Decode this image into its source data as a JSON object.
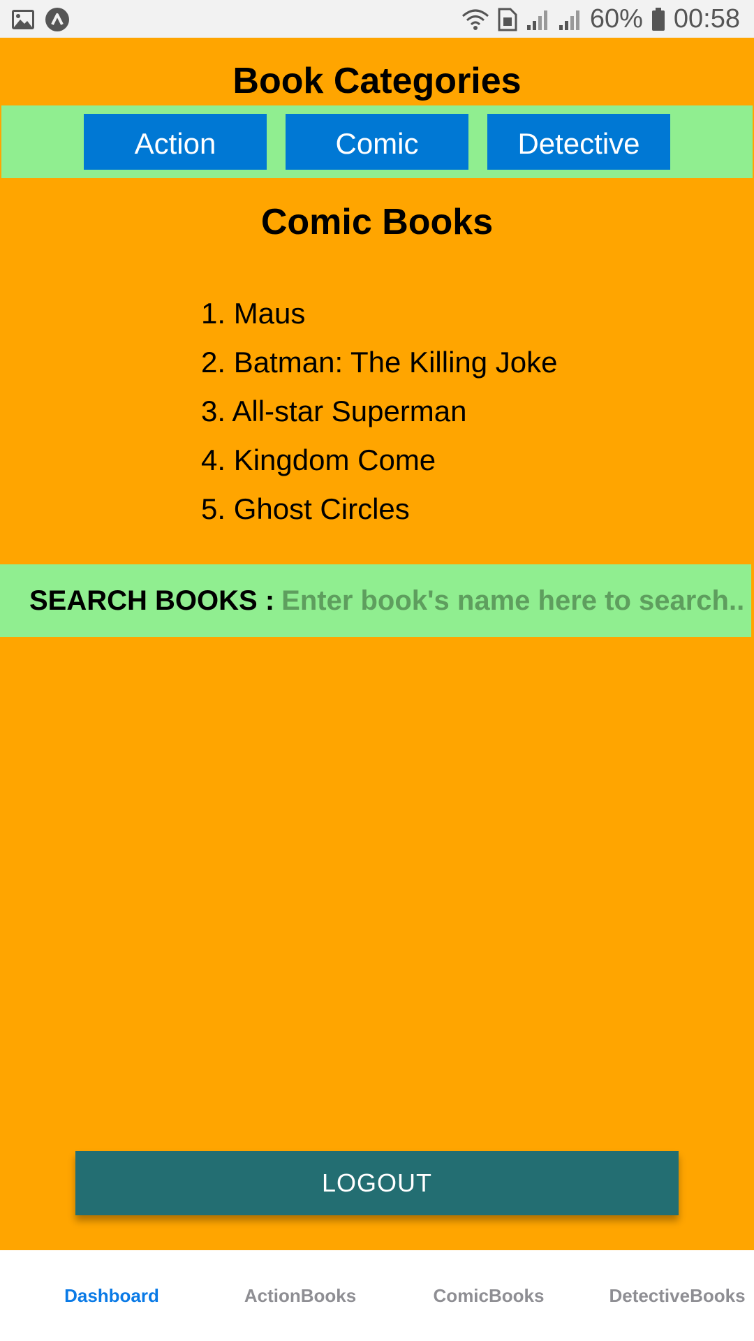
{
  "status_bar": {
    "left_icons": [
      "image-icon",
      "app-icon"
    ],
    "right_icons": [
      "wifi-icon",
      "sim-icon",
      "signal-icon",
      "signal-icon-2",
      "battery-icon"
    ],
    "battery_percent": "60%",
    "time": "00:58"
  },
  "header": {
    "title": "Book Categories"
  },
  "categories": [
    {
      "label": "Action"
    },
    {
      "label": "Comic"
    },
    {
      "label": "Detective"
    }
  ],
  "section": {
    "title": "Comic Books",
    "books": [
      "1. Maus",
      "2. Batman: The Killing Joke",
      "3. All-star Superman",
      "4. Kingdom Come",
      "5. Ghost Circles"
    ]
  },
  "search": {
    "label": "SEARCH BOOKS :",
    "placeholder": "Enter book's name here to search..",
    "value": ""
  },
  "logout": {
    "label": "LOGOUT"
  },
  "tabs": [
    {
      "label": "Dashboard",
      "active": true
    },
    {
      "label": "ActionBooks",
      "active": false
    },
    {
      "label": "ComicBooks",
      "active": false
    },
    {
      "label": "DetectiveBooks",
      "active": false
    }
  ],
  "colors": {
    "background": "#FFA500",
    "bar_green": "#90EE90",
    "button_blue": "#0078D4",
    "logout_teal": "#236E72",
    "tab_active": "#0A7AE6",
    "tab_inactive": "#8E8E93"
  }
}
